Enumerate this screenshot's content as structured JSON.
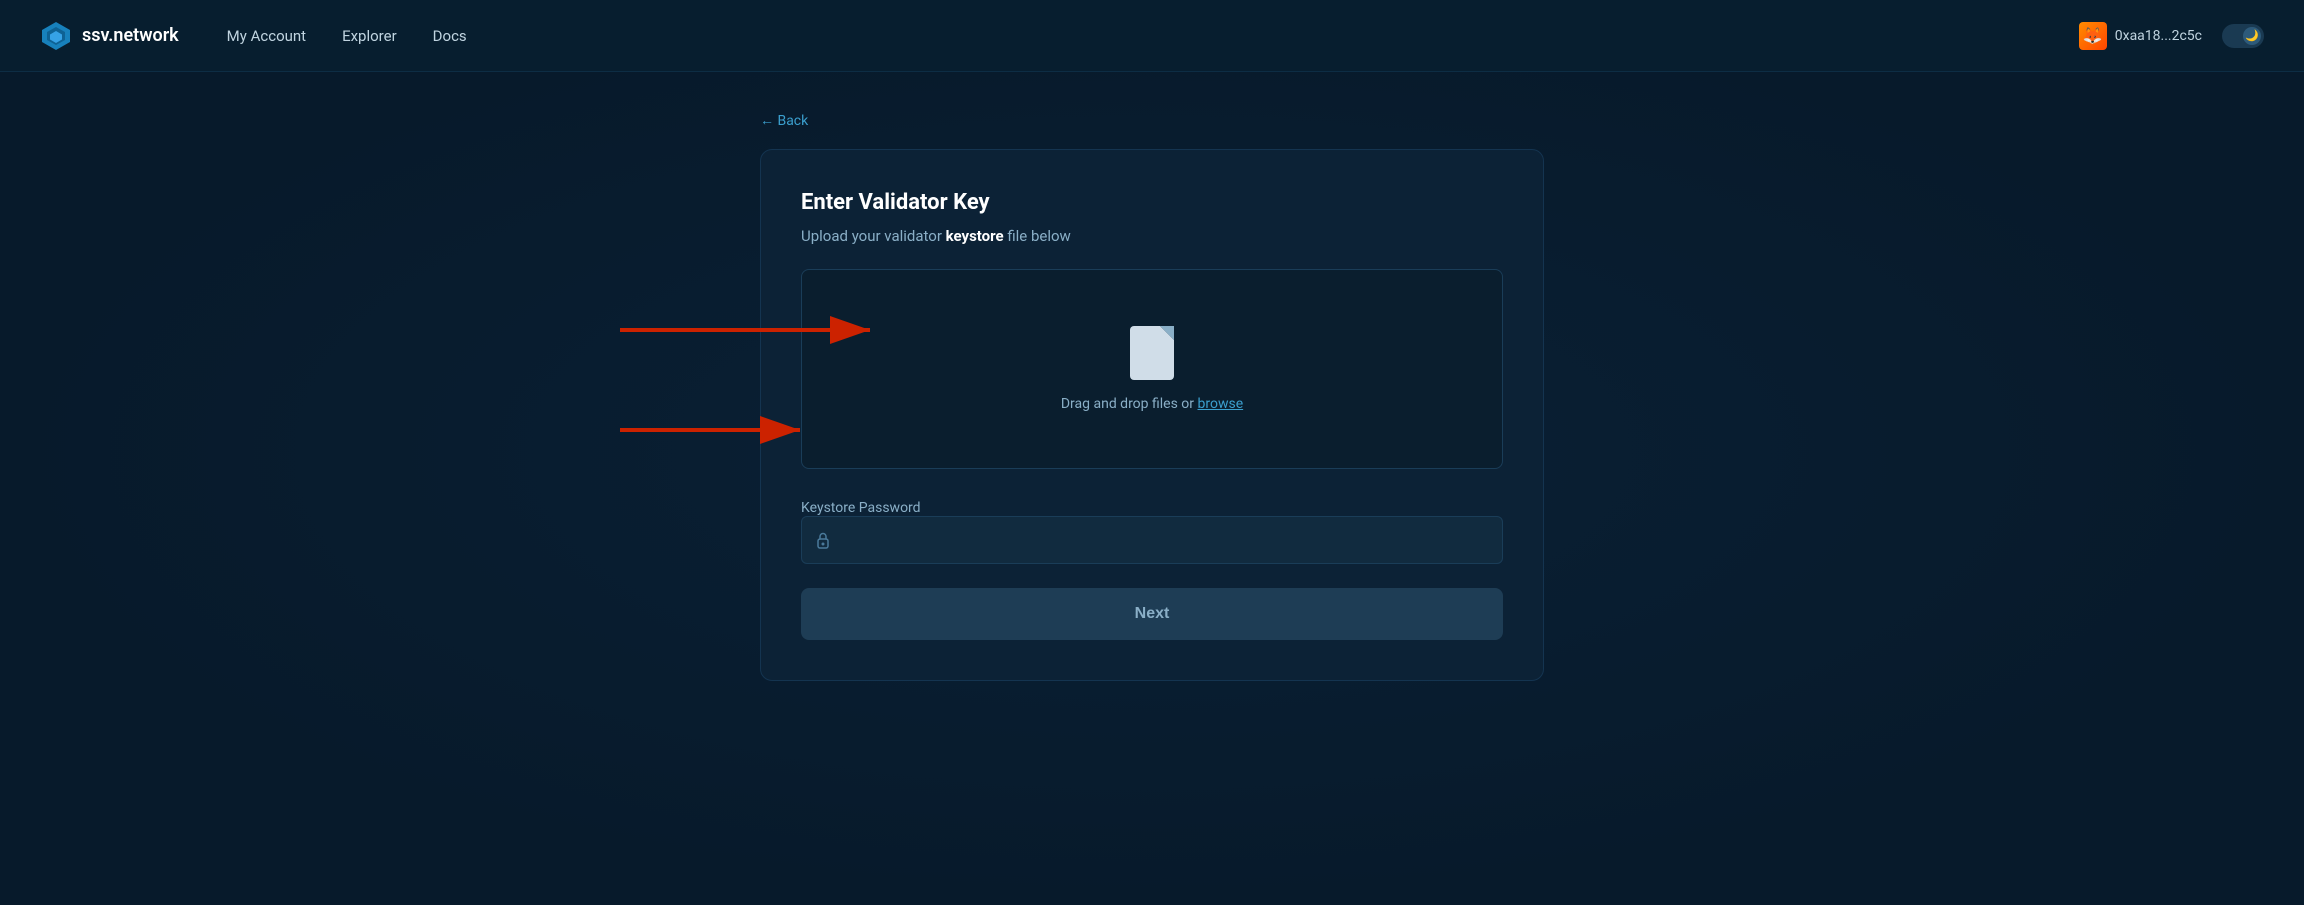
{
  "navbar": {
    "logo_text": "ssv.network",
    "links": [
      {
        "label": "My Account",
        "id": "my-account"
      },
      {
        "label": "Explorer",
        "id": "explorer"
      },
      {
        "label": "Docs",
        "id": "docs"
      }
    ],
    "wallet": {
      "address": "0xaa18...2c5c",
      "avatar_emoji": "🦊"
    },
    "theme_toggle_icon": "🌙"
  },
  "back": {
    "label": "← Back"
  },
  "card": {
    "title": "Enter Validator Key",
    "subtitle_plain": "Upload your validator ",
    "subtitle_bold": "keystore",
    "subtitle_suffix": " file below",
    "drop_zone": {
      "text_plain": "Drag and drop files or ",
      "browse_label": "browse"
    },
    "password_field": {
      "label": "Keystore Password",
      "placeholder": ""
    },
    "next_button_label": "Next"
  }
}
